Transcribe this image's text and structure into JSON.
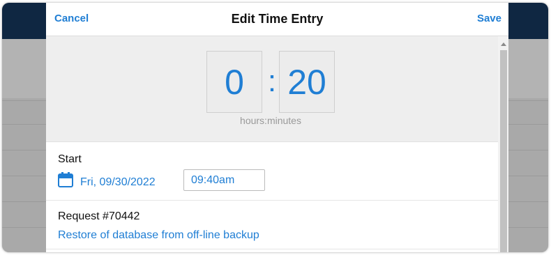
{
  "header": {
    "cancel_label": "Cancel",
    "title": "Edit Time Entry",
    "save_label": "Save"
  },
  "timer": {
    "hours": "0",
    "separator": ":",
    "minutes": "20",
    "units_label": "hours:minutes"
  },
  "start": {
    "label": "Start",
    "date": "Fri, 09/30/2022",
    "time": "09:40am",
    "calendar_icon": "calendar-icon"
  },
  "request": {
    "label": "Request #70442",
    "title": "Restore of database from off-line backup"
  },
  "colors": {
    "accent": "#1f7ed4",
    "background_topbar": "#0f2742",
    "overlay": "#b3b3b3"
  }
}
